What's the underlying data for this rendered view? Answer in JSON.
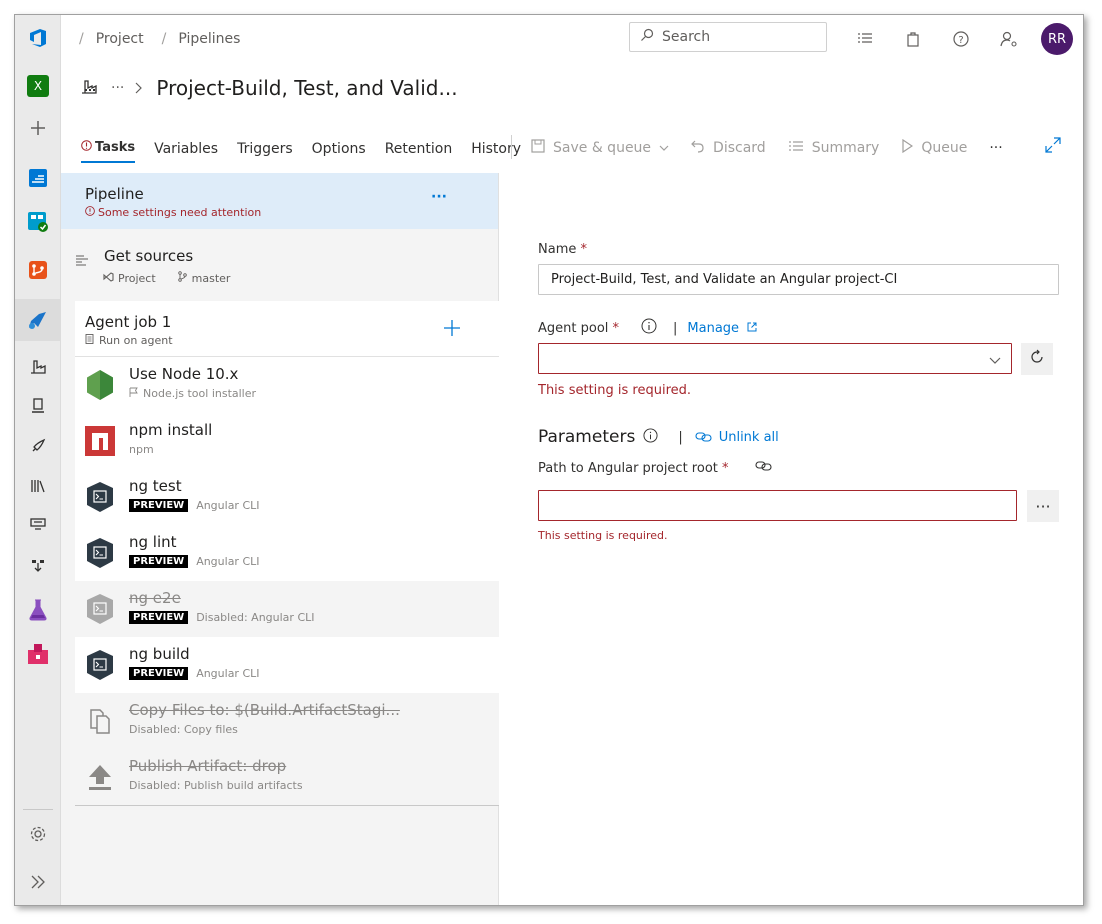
{
  "header": {
    "breadcrumb": [
      "Project",
      "Pipelines"
    ],
    "search_placeholder": "Search",
    "avatar_initials": "RR"
  },
  "title": {
    "more": "···",
    "pipeline_name": "Project-Build, Test, and Valid..."
  },
  "tabs": [
    "Tasks",
    "Variables",
    "Triggers",
    "Options",
    "Retention",
    "History"
  ],
  "toolbar": {
    "save_queue": "Save & queue",
    "discard": "Discard",
    "summary": "Summary",
    "queue": "Queue",
    "more": "···"
  },
  "left": {
    "pipeline": {
      "title": "Pipeline",
      "warning": "Some settings need attention",
      "more": "···"
    },
    "get_sources": {
      "title": "Get sources",
      "repo": "Project",
      "branch": "master"
    },
    "agent_job": {
      "title": "Agent job 1",
      "sub": "Run on agent"
    },
    "tasks": [
      {
        "name": "Use Node 10.x",
        "sub": "Node.js tool installer",
        "badge": "",
        "disabled": false
      },
      {
        "name": "npm install",
        "sub": "npm",
        "badge": "",
        "disabled": false
      },
      {
        "name": "ng test",
        "sub": "Angular CLI",
        "badge": "PREVIEW",
        "disabled": false
      },
      {
        "name": "ng lint",
        "sub": "Angular CLI",
        "badge": "PREVIEW",
        "disabled": false
      },
      {
        "name": "ng e2e",
        "sub": "Disabled: Angular CLI",
        "badge": "PREVIEW",
        "disabled": true
      },
      {
        "name": "ng build",
        "sub": "Angular CLI",
        "badge": "PREVIEW",
        "disabled": false
      },
      {
        "name": "Copy Files to: $(Build.ArtifactStagi...",
        "sub": "Disabled: Copy files",
        "badge": "",
        "disabled": true
      },
      {
        "name": "Publish Artifact: drop",
        "sub": "Disabled: Publish build artifacts",
        "badge": "",
        "disabled": true
      }
    ]
  },
  "right": {
    "name_label": "Name",
    "name_value": "Project-Build, Test, and Validate an Angular project-CI",
    "agent_pool_label": "Agent pool",
    "manage_link": "Manage",
    "required_msg": "This setting is required.",
    "parameters_title": "Parameters",
    "unlink_all": "Unlink all",
    "path_label": "Path to Angular project root",
    "browse": "···"
  },
  "rail": {
    "org_badge": "X"
  },
  "colors": {
    "accent": "#0078d4",
    "error": "#a4262c",
    "avatar": "#4b1a6b"
  }
}
